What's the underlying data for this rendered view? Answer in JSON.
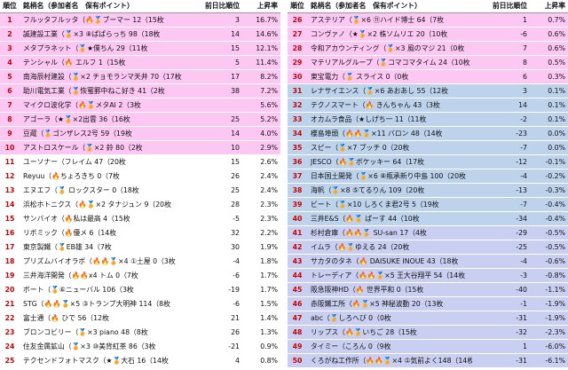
{
  "header": {
    "rank": "順位",
    "name": "銘柄名（参加者名　保有ポイント）",
    "change": "前日比順位",
    "rate": "上昇率"
  },
  "left_rows": [
    {
      "rank": "1",
      "name": "フルッタフルッタ（🔥🏅ブーマー 12（15枚",
      "change": "3",
      "rate": "16.7%",
      "tone": "pink"
    },
    {
      "rank": "2",
      "name": "誠建設工業（🏅×3 ⑧ぱぱらっち 98（18枚",
      "change": "14",
      "rate": "14.6%",
      "tone": "pink"
    },
    {
      "rank": "3",
      "name": "メタプラネット（🏅★僕ちん 29（11枚",
      "change": "15",
      "rate": "12.1%",
      "tone": "pink"
    },
    {
      "rank": "4",
      "name": "テンシャル（🔥 エルフ 1（15枚",
      "change": "5",
      "rate": "11.4%",
      "tone": "pink"
    },
    {
      "rank": "5",
      "name": "南海辰村建設（🏅×2 チョモランマ天井 70（17枚",
      "change": "17",
      "rate": "8.2%",
      "tone": "pink"
    },
    {
      "rank": "6",
      "name": "助川電気工業（🏅恢蜜罫中ねこ好き 41（2枚",
      "change": "38",
      "rate": "7.2%",
      "tone": "pink"
    },
    {
      "rank": "7",
      "name": "マイクロ波化学（🔥🏅メタAI 2（3枚",
      "change": "",
      "rate": "5.6%",
      "tone": "pink"
    },
    {
      "rank": "8",
      "name": "アゴーラ（★🏅×2出雲 36（16枚",
      "change": "25",
      "rate": "5.2%",
      "tone": "pink"
    },
    {
      "rank": "9",
      "name": "豆蔵（🏅ゴンザレス2号 59（19枚",
      "change": "14",
      "rate": "4.0%",
      "tone": "pink"
    },
    {
      "rank": "10",
      "name": "アストロスケール（🏅×2 鈴 80（2枚",
      "change": "10",
      "rate": "2.9%",
      "tone": "pink"
    },
    {
      "rank": "11",
      "name": "ユーソナー（フレイム 47（20枚",
      "change": "15",
      "rate": "2.6%",
      "tone": "white"
    },
    {
      "rank": "12",
      "name": "Reyuu（🔥ちょろきち 0（7枚",
      "change": "26",
      "rate": "2.4%",
      "tone": "white"
    },
    {
      "rank": "13",
      "name": "エヌエフ（🏅 ロックスター 0（18枚",
      "change": "25",
      "rate": "2.4%",
      "tone": "white"
    },
    {
      "rank": "14",
      "name": "浜松ホトニクス（🔥🏅×2 タナジュン 9（20枚",
      "change": "28",
      "rate": "2.3%",
      "tone": "white"
    },
    {
      "rank": "15",
      "name": "サンバイオ（🔥私は最高 4（15枚",
      "change": "-5",
      "rate": "2.3%",
      "tone": "white"
    },
    {
      "rank": "16",
      "name": "リボミック（🔥優メ 6（14枚",
      "change": "32",
      "rate": "2.2%",
      "tone": "white"
    },
    {
      "rank": "17",
      "name": "東京製鐵（🏅EB雄 34（7枚",
      "change": "30",
      "rate": "1.9%",
      "tone": "white"
    },
    {
      "rank": "18",
      "name": "プリズムバイオラボ（🔥🔥🏅×4 ①土屋 0（3枚",
      "change": "-4",
      "rate": "1.8%",
      "tone": "white"
    },
    {
      "rank": "19",
      "name": "三井海洋開発（🔥🔥x4 トム 0（7枚",
      "change": "-6",
      "rate": "1.7%",
      "tone": "white"
    },
    {
      "rank": "20",
      "name": "ボート（🏅⑥ニューバル 106（3枚",
      "change": "-19",
      "rate": "1.7%",
      "tone": "white"
    },
    {
      "rank": "21",
      "name": "STG（🔥🔥🏅×5 ③トランプ大明神 114（8枚",
      "change": "-6",
      "rate": "1.5%",
      "tone": "white"
    },
    {
      "rank": "22",
      "name": "富士通（🔥 ひで 56（12枚",
      "change": "21",
      "rate": "1.4%",
      "tone": "white"
    },
    {
      "rank": "23",
      "name": "ブロンコビリー（🏅×3 piano 48（8枚",
      "change": "26",
      "rate": "1.3%",
      "tone": "white"
    },
    {
      "rank": "24",
      "name": "住友金属鉱山（🏅×3 ⑩美背紅茶 86（3枚",
      "change": "-21",
      "rate": "0.9%",
      "tone": "white"
    },
    {
      "rank": "25",
      "name": "テクセンドフォトマスク（★🏅大石 16（14枚",
      "change": "4",
      "rate": "0.8%",
      "tone": "white"
    }
  ],
  "right_rows": [
    {
      "rank": "26",
      "name": "アステリア（🏅×6 ⑪ハイド博士 64（7枚",
      "change": "1",
      "rate": "0.7%",
      "tone": "pink"
    },
    {
      "rank": "27",
      "name": "コンヴァノ（★🏅×2 株ソムリエ 20（10枚",
      "change": "-6",
      "rate": "0.6%",
      "tone": "pink"
    },
    {
      "rank": "28",
      "name": "令和アカウンティング（🏅×3 風のマジ 21（0枚",
      "change": "7",
      "rate": "0.6%",
      "tone": "pink"
    },
    {
      "rank": "29",
      "name": "マテリアルグループ（🏅コマコマタイム 24（10枚",
      "change": "8",
      "rate": "0.5%",
      "tone": "pink"
    },
    {
      "rank": "30",
      "name": "東宝電力（🏅 スライス 0（0枚",
      "change": "6",
      "rate": "0.3%",
      "tone": "pink"
    },
    {
      "rank": "31",
      "name": "レナサイエンス（🏅×6 あおあし 55（12枚",
      "change": "3",
      "rate": "0.1%",
      "tone": "blue"
    },
    {
      "rank": "32",
      "name": "テクノスマート（🔥 きんちゃん 43（3枚",
      "change": "14",
      "rate": "0.1%",
      "tone": "blue"
    },
    {
      "rank": "33",
      "name": "オカムラ食品（★しげち一 11（11枚",
      "change": "-2",
      "rate": "0.1%",
      "tone": "blue"
    },
    {
      "rank": "34",
      "name": "櫻島埠頭（🔥🔥🏅×11 バロン 48（14枚",
      "change": "-23",
      "rate": "0.0%",
      "tone": "blue"
    },
    {
      "rank": "35",
      "name": "スピー（🏅×7 ブッチ 0（20枚",
      "change": "-7",
      "rate": "0.0%",
      "tone": "blue"
    },
    {
      "rank": "36",
      "name": "JESCO（🔥🏅ボケッキー 64（17枚",
      "change": "-12",
      "rate": "-0.1%",
      "tone": "blue"
    },
    {
      "rank": "37",
      "name": "日本国土開発（🏅×6 ⑧瓶承新り中島 100（20枚",
      "change": "-4",
      "rate": "-0.2%",
      "tone": "blue"
    },
    {
      "rank": "38",
      "name": "海帆（🏅×8 ⑤てるりん 109（20枚",
      "change": "-13",
      "rate": "-0.3%",
      "tone": "blue"
    },
    {
      "rank": "39",
      "name": "ビート（🏅×10 しろくま君2号 5（19枚",
      "change": "-7",
      "rate": "-0.4%",
      "tone": "blue"
    },
    {
      "rank": "40",
      "name": "三井E&S（🔥🏅 ぱーす 44（10枚",
      "change": "-34",
      "rate": "-0.4%",
      "tone": "blue"
    },
    {
      "rank": "41",
      "name": "杉村倉庫（🔥🔥🏅 SU-san 17（4枚",
      "change": "-29",
      "rate": "-0.5%",
      "tone": "lav"
    },
    {
      "rank": "42",
      "name": "イムラ（🔥🏅ゆえる 24（20枚",
      "change": "-25",
      "rate": "-0.5%",
      "tone": "lav"
    },
    {
      "rank": "43",
      "name": "サカタのタネ（🔥 DAISUKE INOUE 43（18枚",
      "change": "-4",
      "rate": "-0.6%",
      "tone": "lav"
    },
    {
      "rank": "44",
      "name": "トレーディア（🔥🔥🏅×5 王大谷翔平 54（14枚",
      "change": "-3",
      "rate": "-0.8%",
      "tone": "lav"
    },
    {
      "rank": "45",
      "name": "阪急阪神HD（🔥 世界平和 0（15枚",
      "change": "-40",
      "rate": "-1.1%",
      "tone": "lav"
    },
    {
      "rank": "46",
      "name": "赤阪鐵工所（🔥🏅×5 神秘波動 20（13枚",
      "change": "-1",
      "rate": "-1.9%",
      "tone": "lav"
    },
    {
      "rank": "47",
      "name": "abc（🏅しろへび 0（0枚",
      "change": "-31",
      "rate": "-1.9%",
      "tone": "lav"
    },
    {
      "rank": "48",
      "name": "リップス（🔥🏅いちご 28（15枚",
      "change": "-32",
      "rate": "-2.3%",
      "tone": "lav"
    },
    {
      "rank": "49",
      "name": "タイミー（ころん 0（9枚",
      "change": "1",
      "rate": "-6.0%",
      "tone": "lav"
    },
    {
      "rank": "50",
      "name": "くろがね工作所（🔥🔥🏅×4 ①気前よく148（14枚",
      "change": "-31",
      "rate": "-6.1%",
      "tone": "lav"
    }
  ]
}
